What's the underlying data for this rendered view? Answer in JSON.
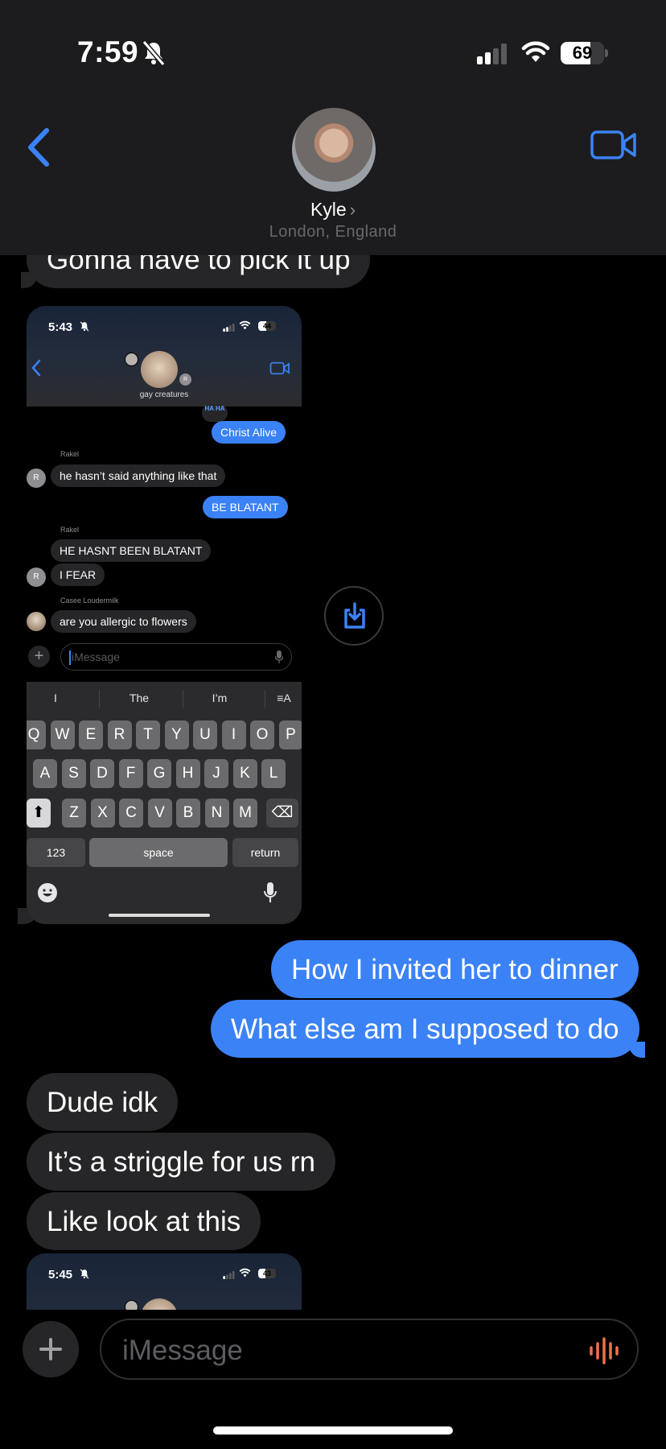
{
  "status_bar": {
    "time": "7:59",
    "battery": "69",
    "battery_level": 0.69
  },
  "header": {
    "contact_name": "Kyle",
    "contact_location": "London, England"
  },
  "messages": {
    "m1": "Gonna have to pick it up",
    "m2": "How I invited her to dinner",
    "m3": "What else am I supposed to do",
    "m4": "Dude idk",
    "m5": "It’s a striggle for us rn",
    "m6": "Like look at this"
  },
  "embedded_1": {
    "time": "5:43",
    "battery": "44",
    "battery_level": 0.44,
    "group_name": "gay creatures",
    "reaction": "HA HA",
    "msg_christ": "Christ Alive",
    "label_rakel_1": "Rakel",
    "msg_rakel_1": "he hasn’t said anything like that",
    "msg_blatant": "BE BLATANT",
    "label_rakel_2": "Rakel",
    "msg_rakel_2": "HE HASNT BEEN BLATANT",
    "msg_rakel_3": "I FEAR",
    "label_casee": "Casee Loudermilk",
    "msg_casee": "are you allergic to flowers",
    "avatar_initial": "R",
    "input_placeholder": "iMessage",
    "suggestions": [
      "I",
      "The",
      "I’m"
    ],
    "keys_row1": [
      "Q",
      "W",
      "E",
      "R",
      "T",
      "Y",
      "U",
      "I",
      "O",
      "P"
    ],
    "keys_row2": [
      "A",
      "S",
      "D",
      "F",
      "G",
      "H",
      "J",
      "K",
      "L"
    ],
    "keys_row3": [
      "Z",
      "X",
      "C",
      "V",
      "B",
      "N",
      "M"
    ],
    "key_123": "123",
    "key_space": "space",
    "key_return": "return"
  },
  "embedded_2": {
    "time": "5:45",
    "battery": "43",
    "battery_level": 0.43
  },
  "input": {
    "placeholder": "iMessage"
  },
  "colors": {
    "sent_bubble": "#3b82f6",
    "recv_bubble": "#262628",
    "accent": "#3b82f6",
    "audio": "#f0714d"
  }
}
